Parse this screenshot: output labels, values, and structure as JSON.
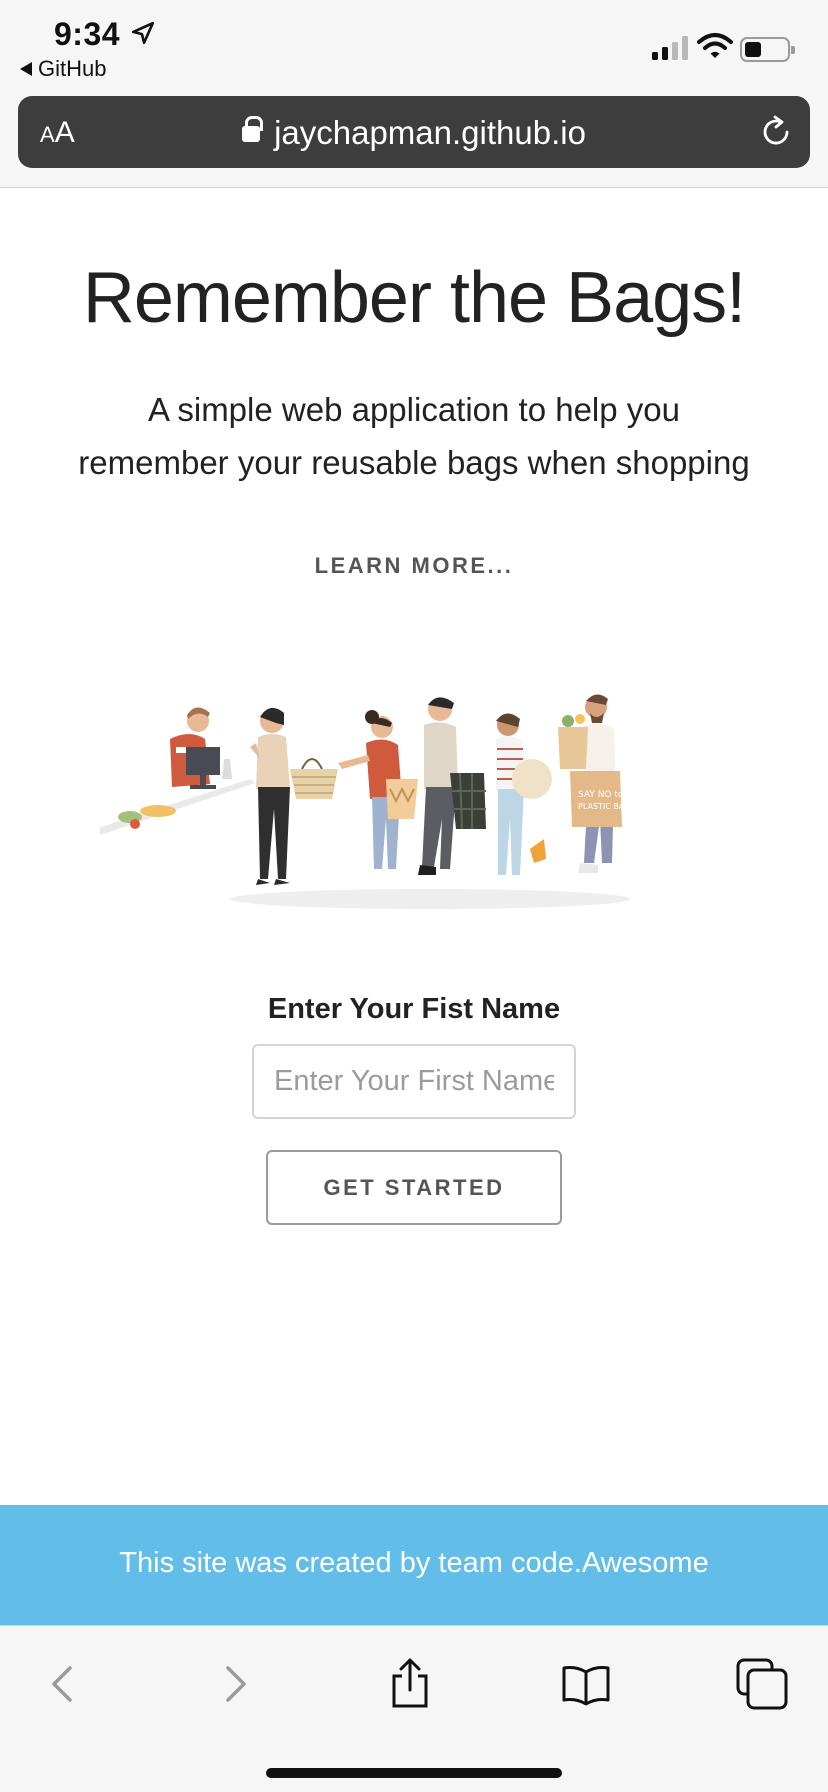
{
  "status_bar": {
    "time": "9:34",
    "back_app": "GitHub",
    "location_icon": "location-arrow-icon",
    "signal_icon": "cellular-signal-icon",
    "wifi_icon": "wifi-icon",
    "battery_icon": "battery-icon"
  },
  "browser": {
    "reader_label": "AA",
    "url": "jaychapman.github.io",
    "lock_icon": "lock-icon",
    "reload_icon": "reload-icon"
  },
  "page": {
    "title": "Remember the Bags!",
    "subtitle_line1": "A simple web application to help you",
    "subtitle_line2": "remember your reusable bags when shopping",
    "learn_more": "LEARN MORE...",
    "name_label": "Enter Your Fist Name",
    "name_placeholder": "Enter Your First Name",
    "name_value": "",
    "start_button": "GET STARTED",
    "illustration": "people-shopping-with-reusable-bags",
    "illustration_bag_text": "SAY NO to PLASTIC BAGS"
  },
  "footer": {
    "text": "This site was created by team code.Awesome",
    "background": "#62bde8"
  },
  "toolbar": {
    "buttons": [
      "back-icon",
      "forward-icon",
      "share-icon",
      "bookmarks-icon",
      "tabs-icon"
    ]
  }
}
